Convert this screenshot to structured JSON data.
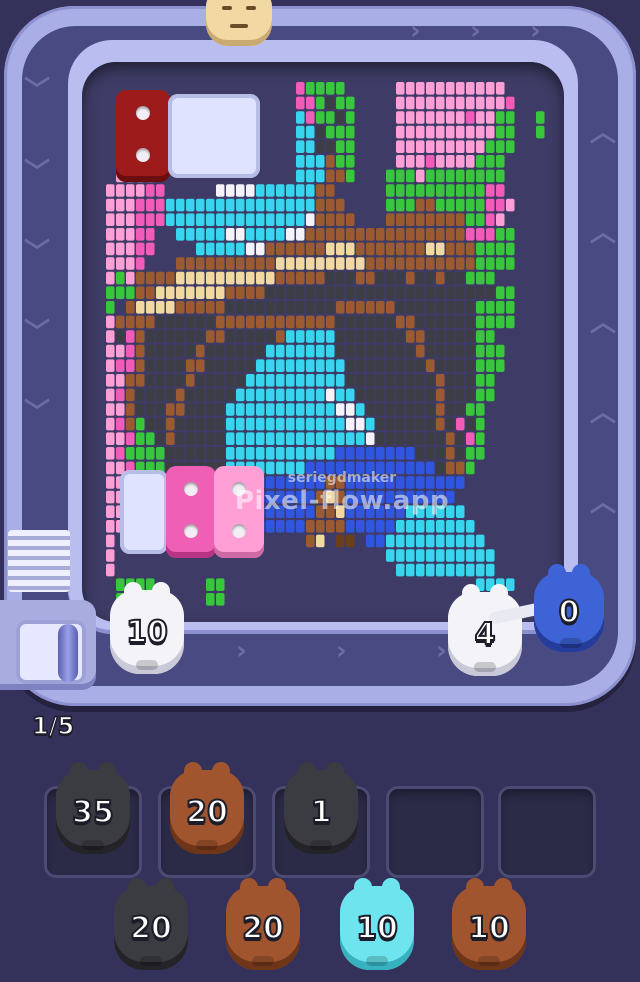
{
  "game": {
    "level_progress": "1/5",
    "watermark_line1": "seriegdmaker",
    "watermark_line2": "Pixel-flow.app"
  },
  "conveyor": {
    "pigs": [
      {
        "color": "white",
        "count": "10"
      },
      {
        "color": "white",
        "count": "4"
      },
      {
        "color": "blue",
        "count": "0"
      }
    ]
  },
  "holding_slots": [
    {
      "color": "black",
      "count": "35"
    },
    {
      "color": "brown",
      "count": "20"
    },
    {
      "color": "black",
      "count": "1"
    },
    {
      "color": "empty",
      "count": ""
    },
    {
      "color": "empty",
      "count": ""
    }
  ],
  "queue": [
    {
      "color": "black",
      "count": "20"
    },
    {
      "color": "brown",
      "count": "20"
    },
    {
      "color": "cyan",
      "count": "10"
    },
    {
      "color": "brown",
      "count": "10"
    }
  ],
  "colors": {
    "background": "#34325a",
    "track": "#a9aee6",
    "pink": "#f25cb8",
    "light_pink": "#ff9fd6",
    "green": "#35c83a",
    "cyan": "#37d7f0",
    "dark_gray": "#3c3c44",
    "brown": "#9c5a2e",
    "tan": "#f0d9a0",
    "blue": "#2f55e0",
    "red_block": "#9c1a1a"
  },
  "pixel_art_palette": {
    "p": "#f25cb8",
    "l": "#ff9fd6",
    "w": "#f4f2f8",
    "g": "#38c63c",
    "c": "#38d6ee",
    "k": "#3d3d46",
    "b": "#9b5a2f",
    "t": "#f1d9a1",
    "u": "#2f56df",
    "n": "#6b3e1c"
  }
}
